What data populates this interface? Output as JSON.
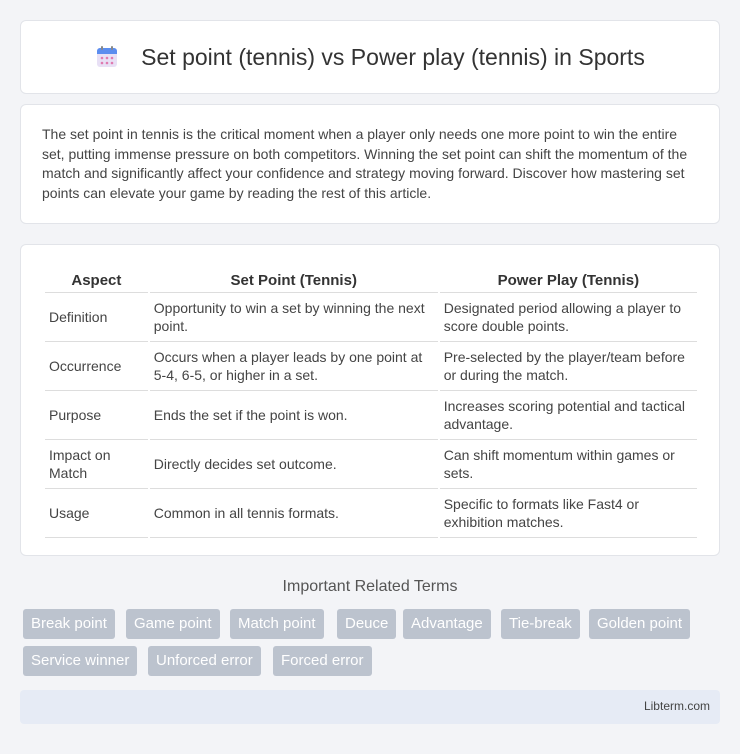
{
  "header": {
    "title": "Set point (tennis) vs Power play (tennis) in Sports",
    "icon": "calendar-icon"
  },
  "intro": {
    "text": "The set point in tennis is the critical moment when a player only needs one more point to win the entire set, putting immense pressure on both competitors. Winning the set point can shift the momentum of the match and significantly affect your confidence and strategy moving forward. Discover how mastering set points can elevate your game by reading the rest of this article."
  },
  "table": {
    "headers": [
      "Aspect",
      "Set Point (Tennis)",
      "Power Play (Tennis)"
    ],
    "rows": [
      [
        "Definition",
        "Opportunity to win a set by winning the next point.",
        "Designated period allowing a player to score double points."
      ],
      [
        "Occurrence",
        "Occurs when a player leads by one point at 5-4, 6-5, or higher in a set.",
        "Pre-selected by the player/team before or during the match."
      ],
      [
        "Purpose",
        "Ends the set if the point is won.",
        "Increases scoring potential and tactical advantage."
      ],
      [
        "Impact on Match",
        "Directly decides set outcome.",
        "Can shift momentum within games or sets."
      ],
      [
        "Usage",
        "Common in all tennis formats.",
        "Specific to formats like Fast4 or exhibition matches."
      ]
    ]
  },
  "related": {
    "title": "Important Related Terms",
    "terms": [
      "Break point",
      "Game point",
      "Match point",
      "Deuce",
      "Advantage",
      "Tie-break",
      "Golden point",
      "Service winner",
      "Unforced error",
      "Forced error"
    ]
  },
  "footer": {
    "site": "Libterm.com"
  }
}
